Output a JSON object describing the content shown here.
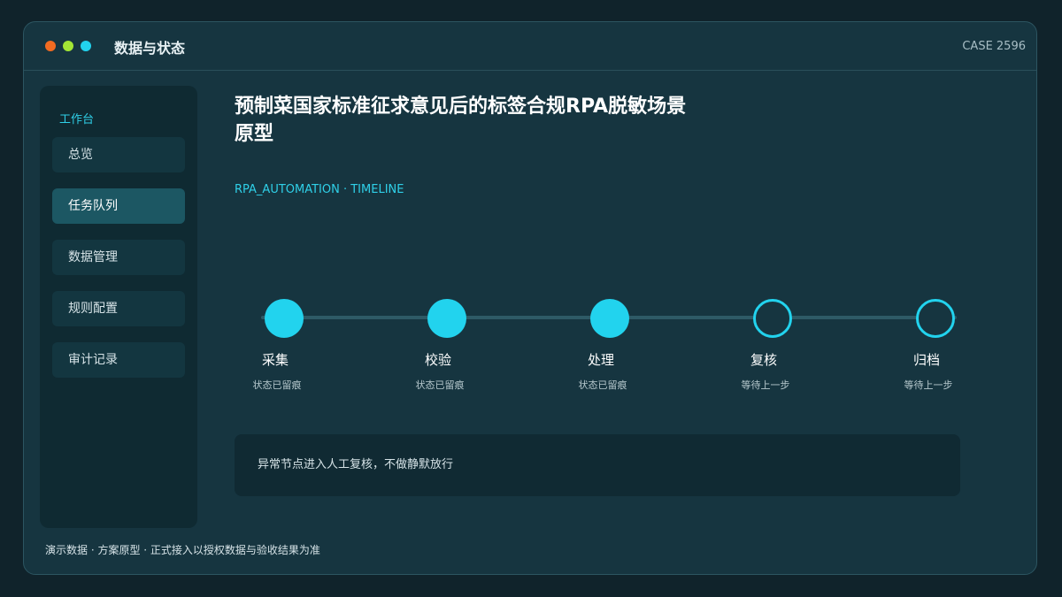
{
  "window": {
    "title": "数据与状态",
    "case_id": "CASE 2596",
    "controls": [
      {
        "name": "close",
        "color": "#f26b21"
      },
      {
        "name": "minimize",
        "color": "#a3e635"
      },
      {
        "name": "maximize",
        "color": "#22d3ee"
      }
    ]
  },
  "sidebar": {
    "header": "工作台",
    "items": [
      {
        "label": "总览",
        "active": false
      },
      {
        "label": "任务队列",
        "active": true
      },
      {
        "label": "数据管理",
        "active": false
      },
      {
        "label": "规则配置",
        "active": false
      },
      {
        "label": "审计记录",
        "active": false
      }
    ]
  },
  "main": {
    "title": "预制菜国家标准征求意见后的标签合规RPA脱敏场景原型",
    "subtitle": "RPA_AUTOMATION · TIMELINE",
    "timeline": [
      {
        "label": "采集",
        "status": "状态已留痕",
        "state": "done"
      },
      {
        "label": "校验",
        "status": "状态已留痕",
        "state": "done"
      },
      {
        "label": "处理",
        "status": "状态已留痕",
        "state": "done"
      },
      {
        "label": "复核",
        "status": "等待上一步",
        "state": "pending"
      },
      {
        "label": "归档",
        "status": "等待上一步",
        "state": "pending"
      }
    ],
    "notice": "异常节点进入人工复核，不做静默放行"
  },
  "footer": "演示数据 · 方案原型 · 正式接入以授权数据与验收结果为准",
  "colors": {
    "accent": "#22d3ee",
    "background": "#10232b",
    "panel": "#163540"
  }
}
